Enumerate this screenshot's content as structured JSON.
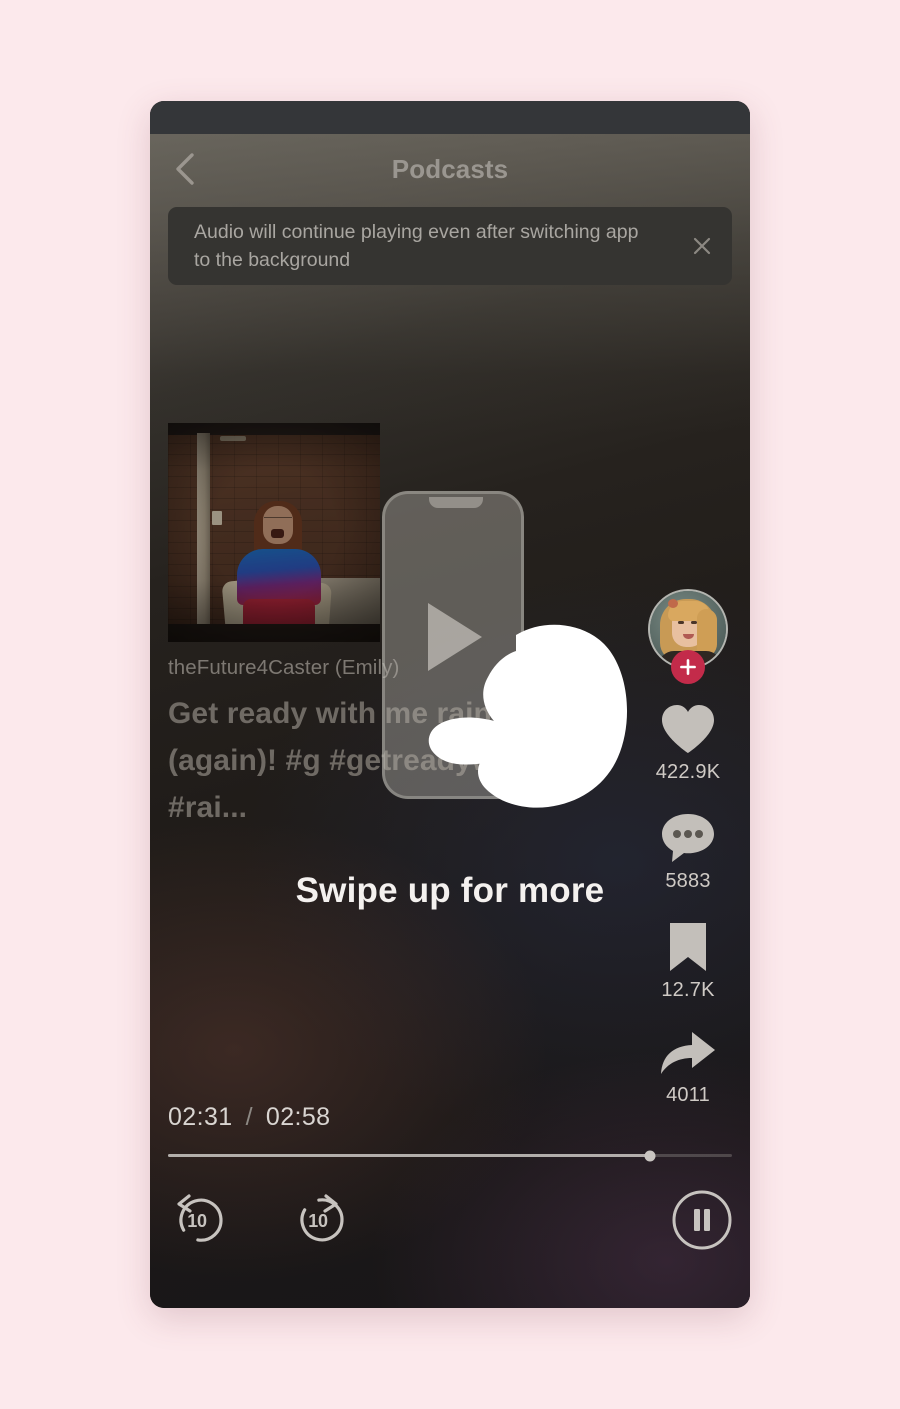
{
  "theme": {
    "page_background": "#fce9ec",
    "status_bar": "#343639",
    "toast_background": "#353431",
    "follow_accent": "#c32b4a",
    "text_muted": "#7d7872",
    "text_bright": "#f4f1ef"
  },
  "header": {
    "title": "Podcasts",
    "back_icon": "chevron-left-icon"
  },
  "toast": {
    "message": "Audio will continue playing even after switching app to the background",
    "close_icon": "close-icon"
  },
  "video": {
    "author": "theFuture4Caster (Emily)",
    "caption": "Get ready with me rainbow (again)! #g #getreadywithme #rai...",
    "thumbnail_alt": "woman in blue and red dress in front of brick wall"
  },
  "swipe_hint": {
    "text": "Swipe up for more",
    "phone_icon": "phone-outline-icon",
    "play_icon": "play-triangle-icon",
    "hand_icon": "pointing-hand-icon"
  },
  "actions": {
    "avatar": {
      "name": "creator-avatar",
      "follow_icon": "plus-icon"
    },
    "items": [
      {
        "icon": "heart-icon",
        "name": "like-button",
        "count": "422.9K"
      },
      {
        "icon": "comment-icon",
        "name": "comment-button",
        "count": "5883"
      },
      {
        "icon": "bookmark-icon",
        "name": "bookmark-button",
        "count": "12.7K"
      },
      {
        "icon": "share-icon",
        "name": "share-button",
        "count": "4011"
      }
    ]
  },
  "player": {
    "current_time": "02:31",
    "separator": "/",
    "total_time": "02:58",
    "progress_percent": 85.5,
    "skip_back_label": "10",
    "skip_back_icon": "replay-10-icon",
    "skip_forward_label": "10",
    "skip_forward_icon": "forward-10-icon",
    "play_pause_icon": "pause-icon",
    "play_pause_state": "playing"
  }
}
